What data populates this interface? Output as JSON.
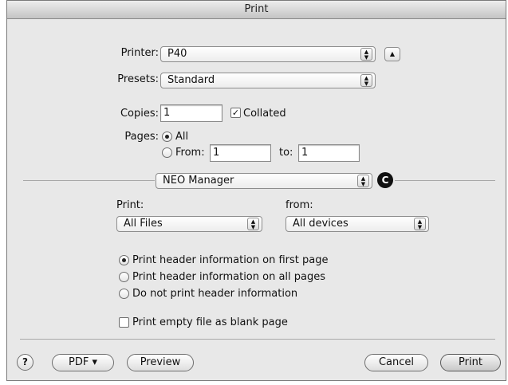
{
  "window": {
    "title": "Print"
  },
  "printer": {
    "label": "Printer:",
    "value": "P40"
  },
  "presets": {
    "label": "Presets:",
    "value": "Standard"
  },
  "copies": {
    "label": "Copies:",
    "value": "1",
    "collated_label": "Collated",
    "collated_checked": true
  },
  "pages": {
    "label": "Pages:",
    "all_label": "All",
    "from_label": "From:",
    "from_value": "1",
    "to_label": "to:",
    "to_value": "1",
    "selected": "All"
  },
  "panel_selector": {
    "value": "NEO Manager",
    "callout": "C"
  },
  "neo": {
    "print_label": "Print:",
    "print_value": "All Files",
    "from_label": "from:",
    "from_value": "All devices",
    "header_options": [
      {
        "label": "Print header information on first page",
        "selected": true
      },
      {
        "label": "Print header information on all pages",
        "selected": false
      },
      {
        "label": "Do not print header information",
        "selected": false
      }
    ],
    "empty_file_label": "Print empty file as blank page",
    "empty_file_checked": false
  },
  "footer": {
    "help_label": "?",
    "pdf_label": "PDF ▾",
    "preview_label": "Preview",
    "cancel_label": "Cancel",
    "print_label": "Print"
  },
  "icons": {
    "stepper": "up-down-arrows-icon",
    "disclosure": "disclosure-triangle-icon",
    "check": "checkmark-icon"
  }
}
